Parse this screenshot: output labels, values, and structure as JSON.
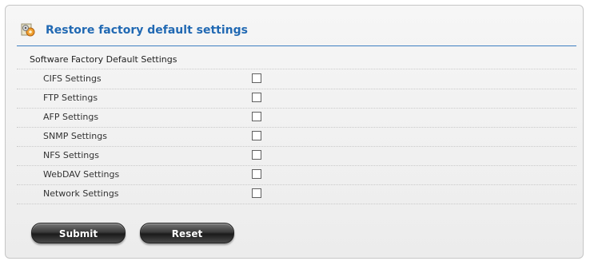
{
  "header": {
    "title": "Restore factory default settings",
    "icon": "restore-gears-icon"
  },
  "section": {
    "title": "Software Factory Default Settings"
  },
  "settings": [
    {
      "label": "CIFS Settings",
      "checked": false
    },
    {
      "label": "FTP Settings",
      "checked": false
    },
    {
      "label": "AFP Settings",
      "checked": false
    },
    {
      "label": "SNMP Settings",
      "checked": false
    },
    {
      "label": "NFS Settings",
      "checked": false
    },
    {
      "label": "WebDAV Settings",
      "checked": false
    },
    {
      "label": "Network Settings",
      "checked": false
    }
  ],
  "buttons": {
    "submit_label": "Submit",
    "reset_label": "Reset"
  },
  "colors": {
    "accent": "#2169b3",
    "header_rule": "#3d7fc1",
    "panel_background": "#f1f1f1"
  }
}
